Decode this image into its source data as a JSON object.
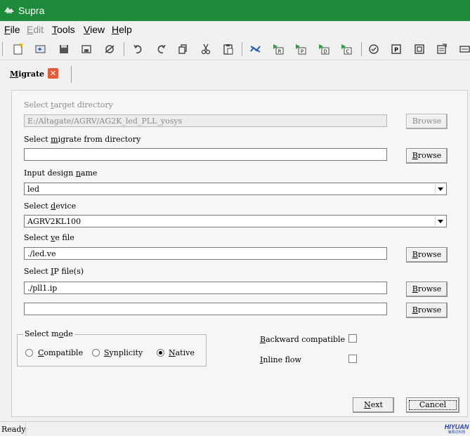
{
  "window": {
    "title": "Supra"
  },
  "menubar": {
    "items": [
      {
        "label": "File",
        "mnemonic": "F",
        "rest": "ile",
        "enabled": true
      },
      {
        "label": "Edit",
        "mnemonic": "E",
        "rest": "dit",
        "enabled": false
      },
      {
        "label": "Tools",
        "mnemonic": "T",
        "rest": "ools",
        "enabled": true
      },
      {
        "label": "View",
        "mnemonic": "V",
        "rest": "iew",
        "enabled": true
      },
      {
        "label": "Help",
        "mnemonic": "H",
        "rest": "elp",
        "enabled": true
      }
    ]
  },
  "toolbar": {
    "icons": [
      "new-file-icon",
      "open-file-icon",
      "save-icon",
      "save-all-icon",
      "print-icon",
      "undo-icon",
      "redo-icon",
      "copy-icon",
      "cut-icon",
      "paste-icon",
      "run-icon",
      "run-r-icon",
      "run-p-icon",
      "run-d-icon",
      "run-c-icon",
      "check-icon",
      "tool-p-icon",
      "tool-d-icon",
      "report-icon",
      "more-icon"
    ]
  },
  "tab": {
    "label": "Migrate",
    "mnemonic": "M",
    "rest": "igrate",
    "close_icon": "close-icon",
    "close_color": "#e25b3b"
  },
  "form": {
    "target_dir": {
      "pre": "Select ",
      "mnemonic": "t",
      "post": "arget directory",
      "value": "E:/Altagate/AGRV/AG2K_led_PLL_yosys",
      "browse": "Browse"
    },
    "migrate_from": {
      "pre": "Select ",
      "mnemonic": "m",
      "post": "igrate from directory",
      "value": "",
      "browse": "Browse"
    },
    "design_name": {
      "pre": "Input design ",
      "mnemonic": "n",
      "post": "ame",
      "value": "led"
    },
    "device": {
      "pre": "Select ",
      "mnemonic": "d",
      "post": "evice",
      "value": "AGRV2KL100"
    },
    "ve_file": {
      "pre": "Select ",
      "mnemonic": "v",
      "post": "e file",
      "value": "./led.ve",
      "browse": "Browse"
    },
    "ip_files": {
      "pre": "Select ",
      "mnemonic": "I",
      "post": "P file(s)",
      "value1": "./pll1.ip",
      "value2": "",
      "browse1": "Browse",
      "browse2": "Browse"
    }
  },
  "mode": {
    "title_pre": "Select m",
    "title_mnemonic": "o",
    "title_post": "de",
    "options": [
      {
        "mnemonic": "C",
        "rest": "ompatible",
        "checked": false
      },
      {
        "mnemonic": "S",
        "rest": "ynplicity",
        "checked": false
      },
      {
        "mnemonic": "N",
        "rest": "ative",
        "checked": true
      }
    ]
  },
  "backward": {
    "mnemonic": "B",
    "rest": "ackward compatible",
    "checked": false
  },
  "inline": {
    "mnemonic": "I",
    "rest": "nline flow",
    "checked": false
  },
  "buttons": {
    "next": {
      "mnemonic": "N",
      "rest": "ext"
    },
    "cancel": "Cancel"
  },
  "status": {
    "text": "Ready"
  },
  "logo": {
    "line1": "HIYUAN",
    "line2": "海辰达科技"
  },
  "colors": {
    "titlebar": "#1e8a3c",
    "toolbar_green": "#2e9e3e",
    "toolbar_blue": "#2a5db0"
  }
}
